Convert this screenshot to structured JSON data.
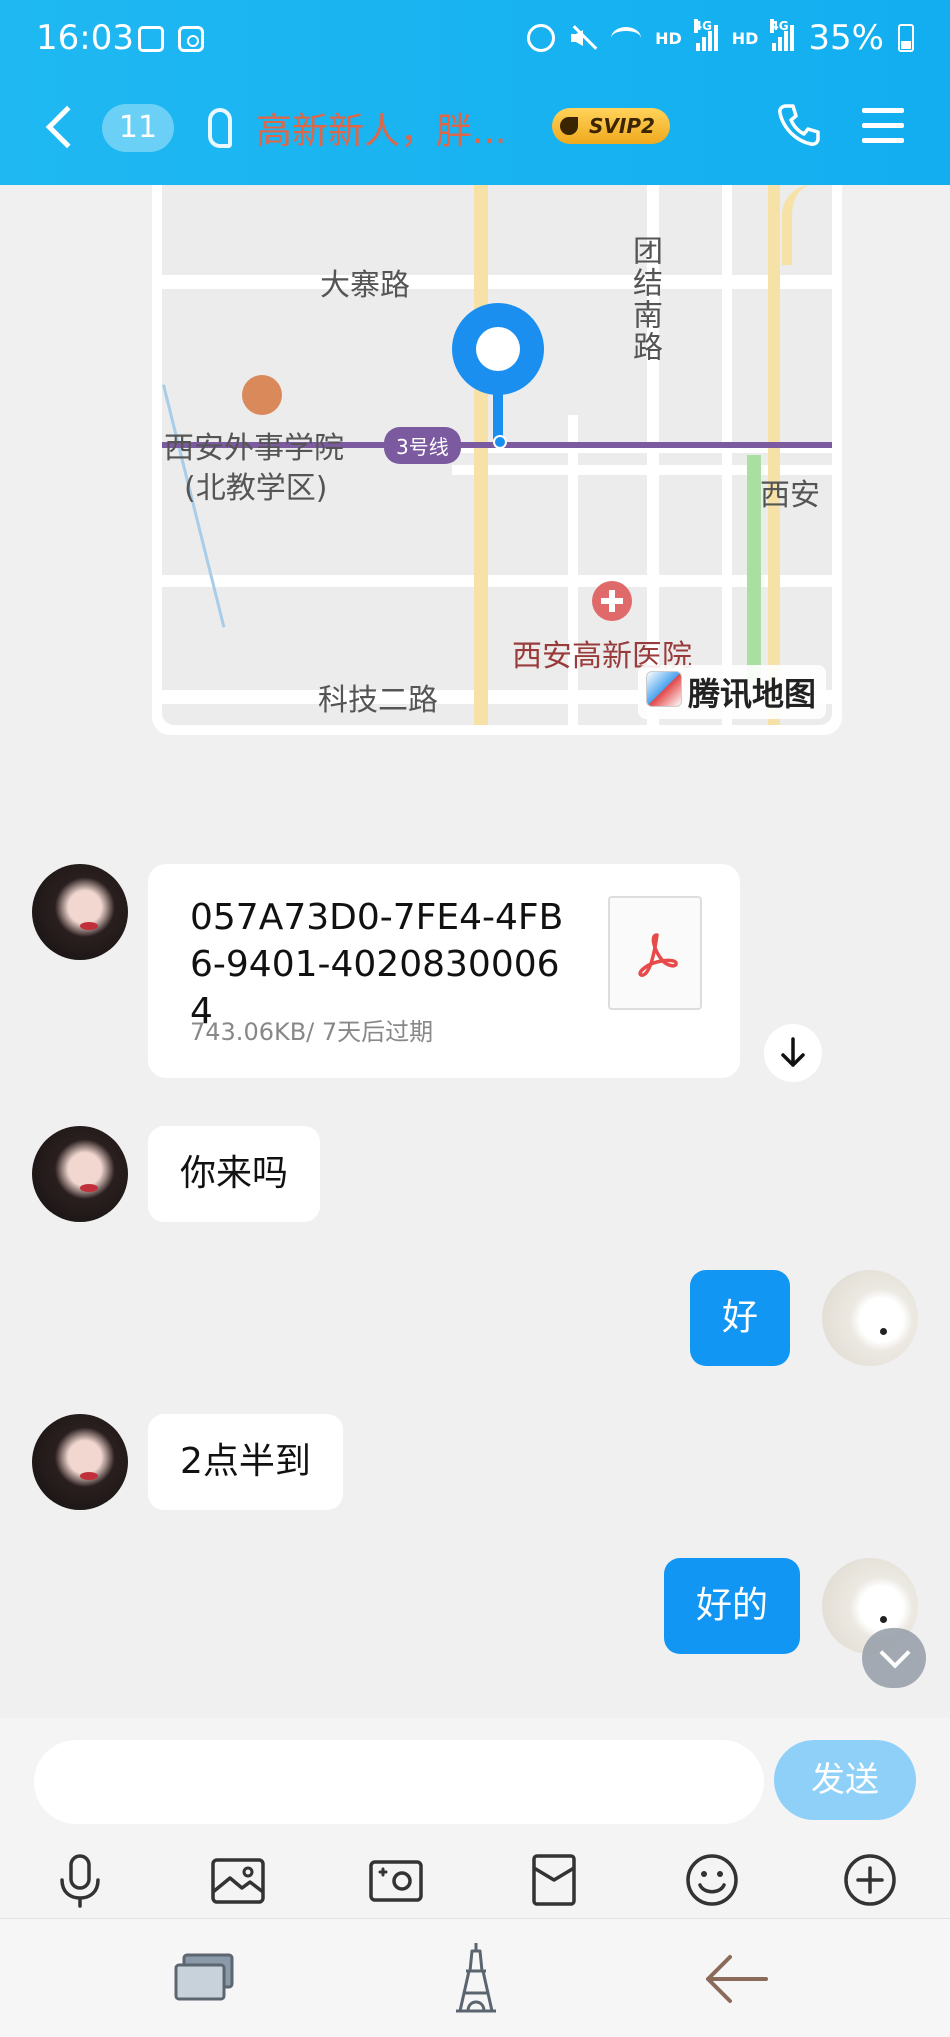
{
  "status_bar": {
    "time": "16:03",
    "network_left": "HD",
    "network_right": "HD",
    "gen_left": "4G",
    "gen_right": "4G",
    "battery": "35%"
  },
  "header": {
    "unread_count": "11",
    "chat_title": "高新新人，胖...",
    "vip_badge": "SVIP2"
  },
  "map": {
    "labels": {
      "road_dazhai": "大寨路",
      "road_tuanjie_south": "团结南路",
      "school": "西安外事学院",
      "school_campus": "(北教学区)",
      "metro_line": "3号线",
      "xian_partial": "西安",
      "hospital": "西安高新医院",
      "road_keji2": "科技二路"
    },
    "provider": "腾讯地图",
    "pin_color": "#1a8ff0"
  },
  "messages": {
    "file": {
      "name": "057A73D0-7FE4-4FB6-9401-40208300064",
      "meta": "743.06KB/ 7天后过期",
      "icon": "pdf-icon"
    },
    "m1": "你来吗",
    "m2": "好",
    "m3": "2点半到",
    "m4": "好的"
  },
  "composer": {
    "input_value": "",
    "send_label": "发送"
  },
  "colors": {
    "header_bg": "#1fb8f2",
    "outgoing_bubble": "#1296f3",
    "send_button": "#8fd0f8",
    "title_color": "#e06648"
  }
}
